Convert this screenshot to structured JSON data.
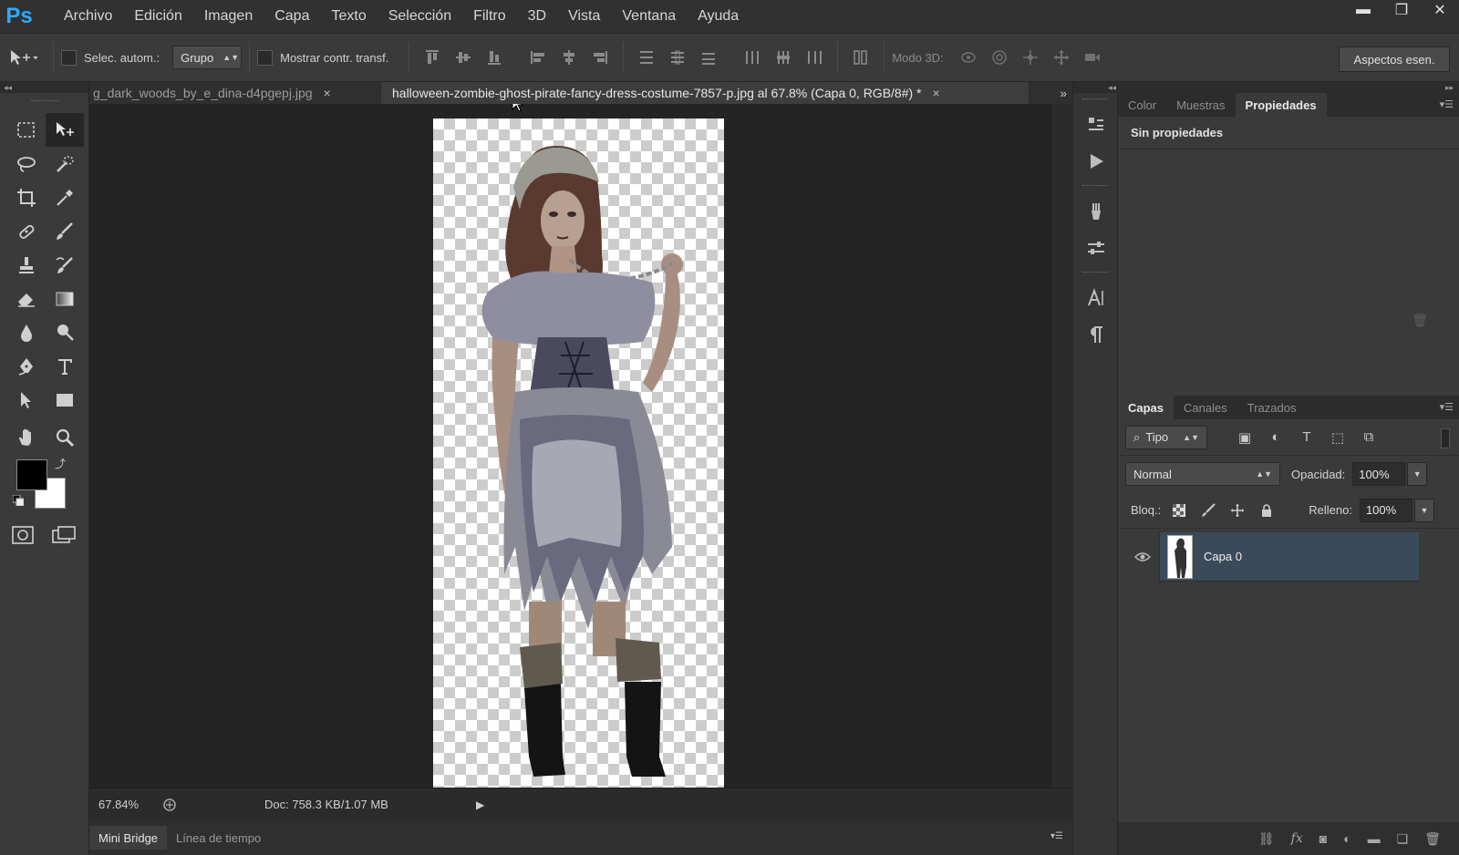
{
  "app": {
    "logo": "Ps"
  },
  "menu": [
    "Archivo",
    "Edición",
    "Imagen",
    "Capa",
    "Texto",
    "Selección",
    "Filtro",
    "3D",
    "Vista",
    "Ventana",
    "Ayuda"
  ],
  "window_controls": {
    "minimize": "▬",
    "restore": "❐",
    "close": "✕"
  },
  "options": {
    "auto_select_label": "Selec. autom.:",
    "auto_select_value": "Grupo",
    "show_transform_label": "Mostrar contr. transf.",
    "mode3d_label": "Modo 3D:",
    "workspace_button": "Aspectos esen."
  },
  "tabs": [
    {
      "label": "g_dark_woods_by_e_dina-d4pgepj.jpg",
      "close": "×"
    },
    {
      "label": "halloween-zombie-ghost-pirate-fancy-dress-costume-7857-p.jpg al 67.8% (Capa 0, RGB/8#) *",
      "close": "×"
    }
  ],
  "status": {
    "zoom": "67.84%",
    "doc": "Doc: 758.3 KB/1.07 MB"
  },
  "bottom_tabs": [
    "Mini Bridge",
    "Línea de tiempo"
  ],
  "properties_panel": {
    "tabs": [
      "Color",
      "Muestras",
      "Propiedades"
    ],
    "active_tab": "Propiedades",
    "body_text": "Sin propiedades"
  },
  "layers_panel": {
    "tabs": [
      "Capas",
      "Canales",
      "Trazados"
    ],
    "filter_label": "Tipo",
    "blend_mode": "Normal",
    "opacity_label": "Opacidad:",
    "opacity_value": "100%",
    "lock_label": "Bloq.:",
    "fill_label": "Relleno:",
    "fill_value": "100%",
    "layers": [
      {
        "name": "Capa 0",
        "visible": true,
        "selected": true
      }
    ]
  },
  "colors": {
    "accent": "#31a8ff",
    "foreground": "#000000",
    "background": "#ffffff",
    "selected_layer": "#3a4a5a"
  }
}
